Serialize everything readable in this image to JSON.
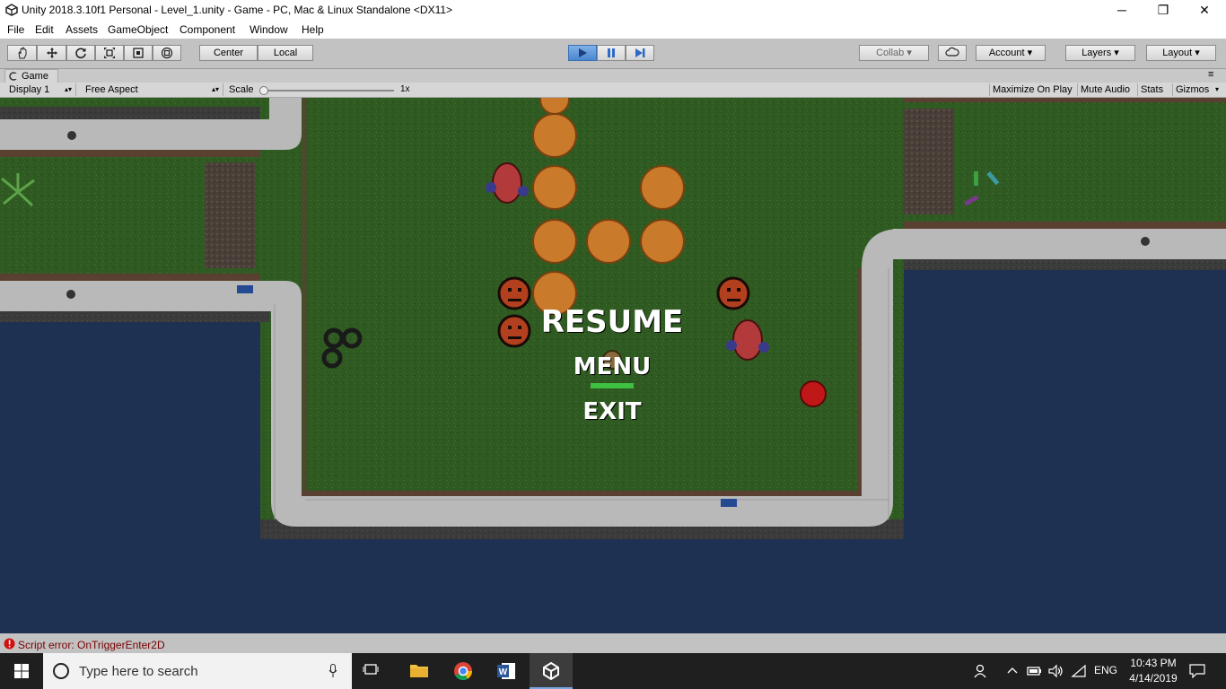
{
  "window": {
    "title": "Unity 2018.3.10f1 Personal - Level_1.unity - Game - PC, Mac & Linux Standalone <DX11>",
    "minimize": "─",
    "maximize": "❐",
    "close": "✕"
  },
  "menu": [
    "File",
    "Edit",
    "Assets",
    "GameObject",
    "Component",
    "Window",
    "Help"
  ],
  "toolbar": {
    "pivot": "Center",
    "space": "Local",
    "collab": "Collab",
    "account": "Account",
    "layers": "Layers",
    "layout": "Layout"
  },
  "game_panel": {
    "tab": "Game",
    "display": "Display 1",
    "aspect": "Free Aspect",
    "scale_label": "Scale",
    "scale_value": "1x",
    "maximize_on_play": "Maximize On Play",
    "mute_audio": "Mute Audio",
    "stats": "Stats",
    "gizmos": "Gizmos"
  },
  "pause_menu": {
    "resume": "RESUME",
    "menu": "MENU",
    "exit": "EXIT"
  },
  "status": {
    "error": "Script error: OnTriggerEnter2D"
  },
  "taskbar": {
    "search_placeholder": "Type here to search",
    "language": "ENG",
    "time": "10:43 PM",
    "date": "4/14/2019"
  },
  "colors": {
    "grass": "#2f5a21",
    "water": "#1f3152",
    "sidewalk": "#b9b9b9",
    "play_active": "#4a86d0"
  },
  "icons": [
    "unity-logo",
    "hand-tool-icon",
    "move-tool-icon",
    "rotate-tool-icon",
    "scale-tool-icon",
    "rect-tool-icon",
    "transform-tool-icon",
    "play-icon",
    "pause-icon",
    "step-icon",
    "cloud-icon",
    "error-icon",
    "windows-icon",
    "search-icon",
    "microphone-icon",
    "task-view-icon",
    "file-explorer-icon",
    "chrome-icon",
    "word-icon",
    "unity-taskbar-icon"
  ]
}
